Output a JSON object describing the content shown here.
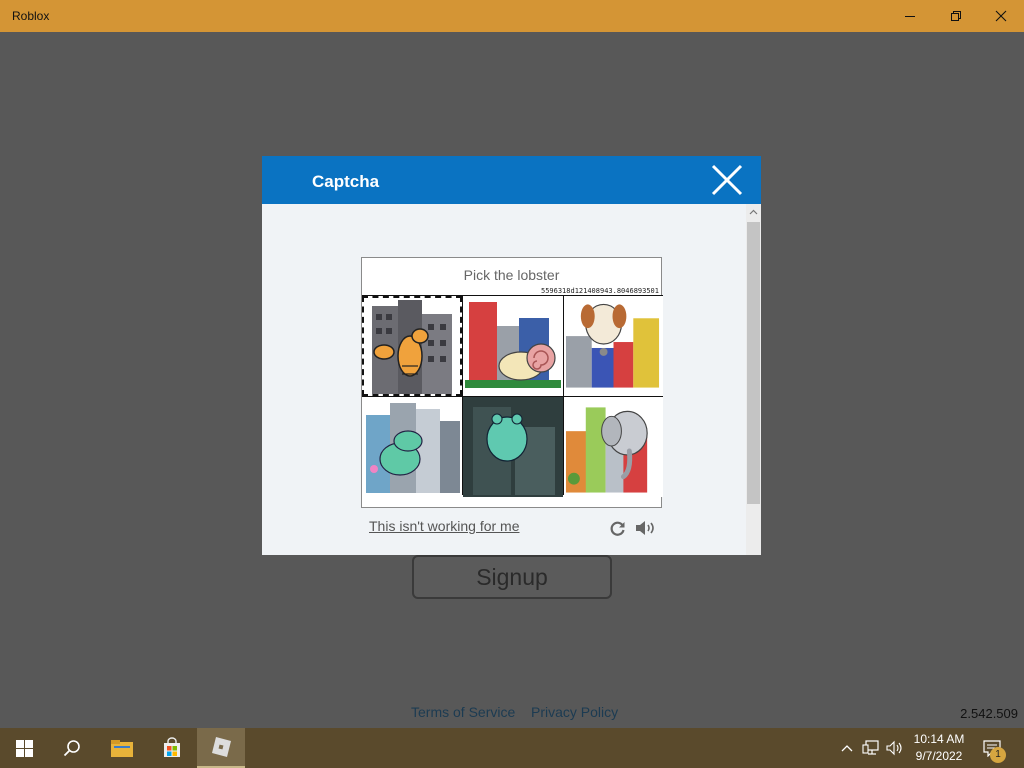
{
  "window": {
    "title": "Roblox",
    "controls": [
      "minimize-icon",
      "restore-icon",
      "close-icon"
    ]
  },
  "app": {
    "signup_label": "Signup",
    "footer_links": [
      "Terms of Service",
      "Privacy Policy"
    ],
    "version": "2.542.509"
  },
  "captcha": {
    "title": "Captcha",
    "prompt": "Pick the lobster",
    "challenge_id": "5596318d121408943.8046893501",
    "tiles": [
      "lobster",
      "snail",
      "dog",
      "dinosaur",
      "frog",
      "elephant"
    ],
    "selected_tile": "lobster",
    "not_working_label": "This isn't working for me",
    "icons": [
      "reload-icon",
      "audio-icon"
    ]
  },
  "taskbar": {
    "apps": [
      "windows-start-icon",
      "search-icon",
      "file-explorer-icon",
      "microsoft-store-icon",
      "roblox-icon"
    ],
    "active_app": "roblox-icon",
    "time": "10:14 AM",
    "date": "9/7/2022",
    "notification_count": "1"
  },
  "colors": {
    "titlebar": "#d49535",
    "dialog_header": "#0a73c2",
    "taskbar": "#5a4a2c",
    "background": "#585858"
  }
}
